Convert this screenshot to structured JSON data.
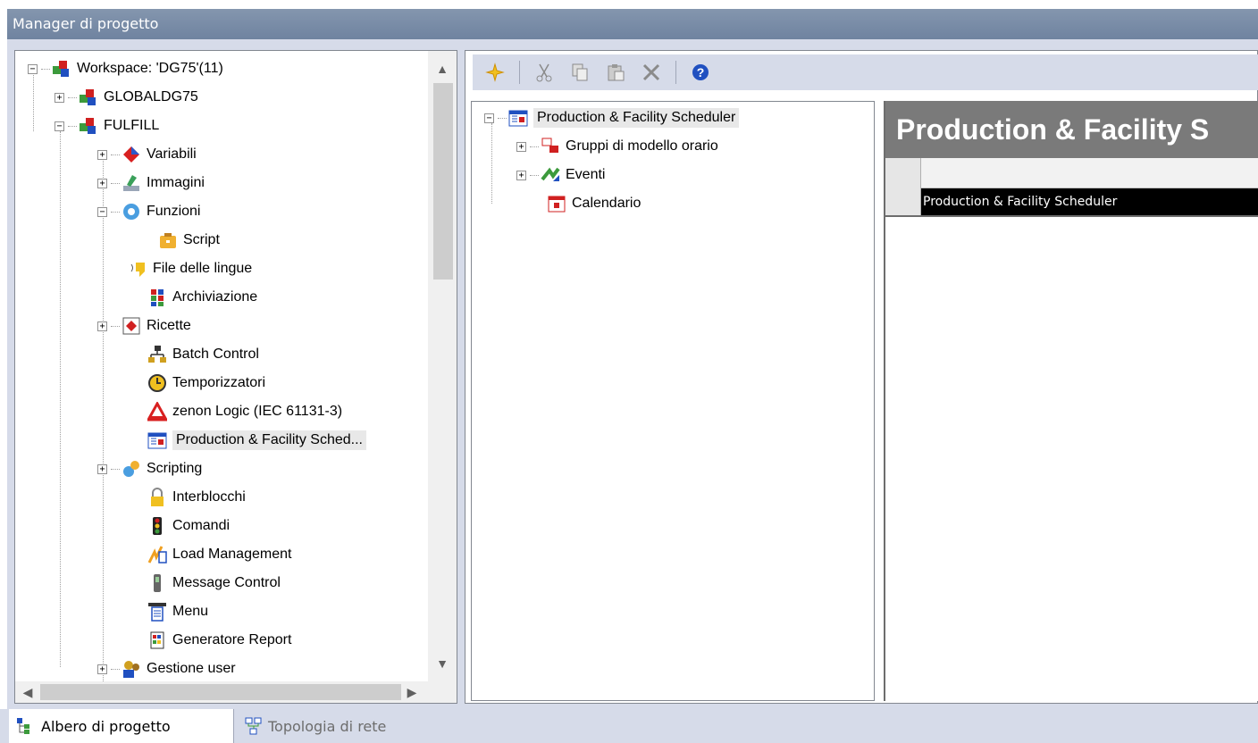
{
  "window": {
    "title": "Manager di progetto"
  },
  "project_tree": {
    "items": [
      {
        "label": "Workspace: 'DG75'(11)",
        "icon": "workspace-icon",
        "expander": "−"
      },
      {
        "label": "GLOBALDG75",
        "icon": "project-icon",
        "expander": "+"
      },
      {
        "label": "FULFILL",
        "icon": "project-icon",
        "expander": "−"
      },
      {
        "label": "Variabili",
        "icon": "variables-icon",
        "expander": "+"
      },
      {
        "label": "Immagini",
        "icon": "screens-icon",
        "expander": "+"
      },
      {
        "label": "Funzioni",
        "icon": "functions-icon",
        "expander": "−"
      },
      {
        "label": "Script",
        "icon": "script-icon",
        "expander": ""
      },
      {
        "label": "File delle lingue",
        "icon": "language-files-icon",
        "expander": ""
      },
      {
        "label": "Archiviazione",
        "icon": "archive-icon",
        "expander": ""
      },
      {
        "label": "Ricette",
        "icon": "recipes-icon",
        "expander": "+"
      },
      {
        "label": "Batch Control",
        "icon": "batch-control-icon",
        "expander": ""
      },
      {
        "label": "Temporizzatori",
        "icon": "timer-icon",
        "expander": ""
      },
      {
        "label": "zenon Logic (IEC 61131-3)",
        "icon": "zenon-logic-icon",
        "expander": ""
      },
      {
        "label": "Production & Facility Sched...",
        "icon": "scheduler-icon",
        "expander": "",
        "selected": true
      },
      {
        "label": "Scripting",
        "icon": "scripting-icon",
        "expander": "+"
      },
      {
        "label": "Interblocchi",
        "icon": "interlock-icon",
        "expander": ""
      },
      {
        "label": "Comandi",
        "icon": "commands-icon",
        "expander": ""
      },
      {
        "label": "Load Management",
        "icon": "load-management-icon",
        "expander": ""
      },
      {
        "label": "Message Control",
        "icon": "message-control-icon",
        "expander": ""
      },
      {
        "label": "Menu",
        "icon": "menu-icon",
        "expander": ""
      },
      {
        "label": "Generatore Report",
        "icon": "report-generator-icon",
        "expander": ""
      },
      {
        "label": "Gestione user",
        "icon": "user-management-icon",
        "expander": "+"
      }
    ]
  },
  "toolbar": {
    "buttons": [
      "new-icon",
      "cut-icon",
      "copy-icon",
      "paste-icon",
      "delete-icon",
      "help-icon"
    ]
  },
  "scheduler_tree": {
    "root": "Production & Facility Scheduler",
    "children": [
      {
        "label": "Gruppi di modello orario",
        "icon": "time-model-group-icon",
        "expander": "+"
      },
      {
        "label": "Eventi",
        "icon": "events-icon",
        "expander": "+"
      },
      {
        "label": "Calendario",
        "icon": "calendar-icon",
        "expander": ""
      }
    ]
  },
  "detail": {
    "title": "Production & Facility S",
    "rows": [
      "Production & Facility Scheduler"
    ]
  },
  "tabs": [
    {
      "label": "Albero di progetto",
      "active": true
    },
    {
      "label": "Topologia di rete",
      "active": false
    }
  ],
  "colors": {
    "titlebar": "#7b8ea8",
    "frame": "#d6dbe9",
    "detail_header": "#7a7a7a",
    "selected_row": "#000000"
  }
}
